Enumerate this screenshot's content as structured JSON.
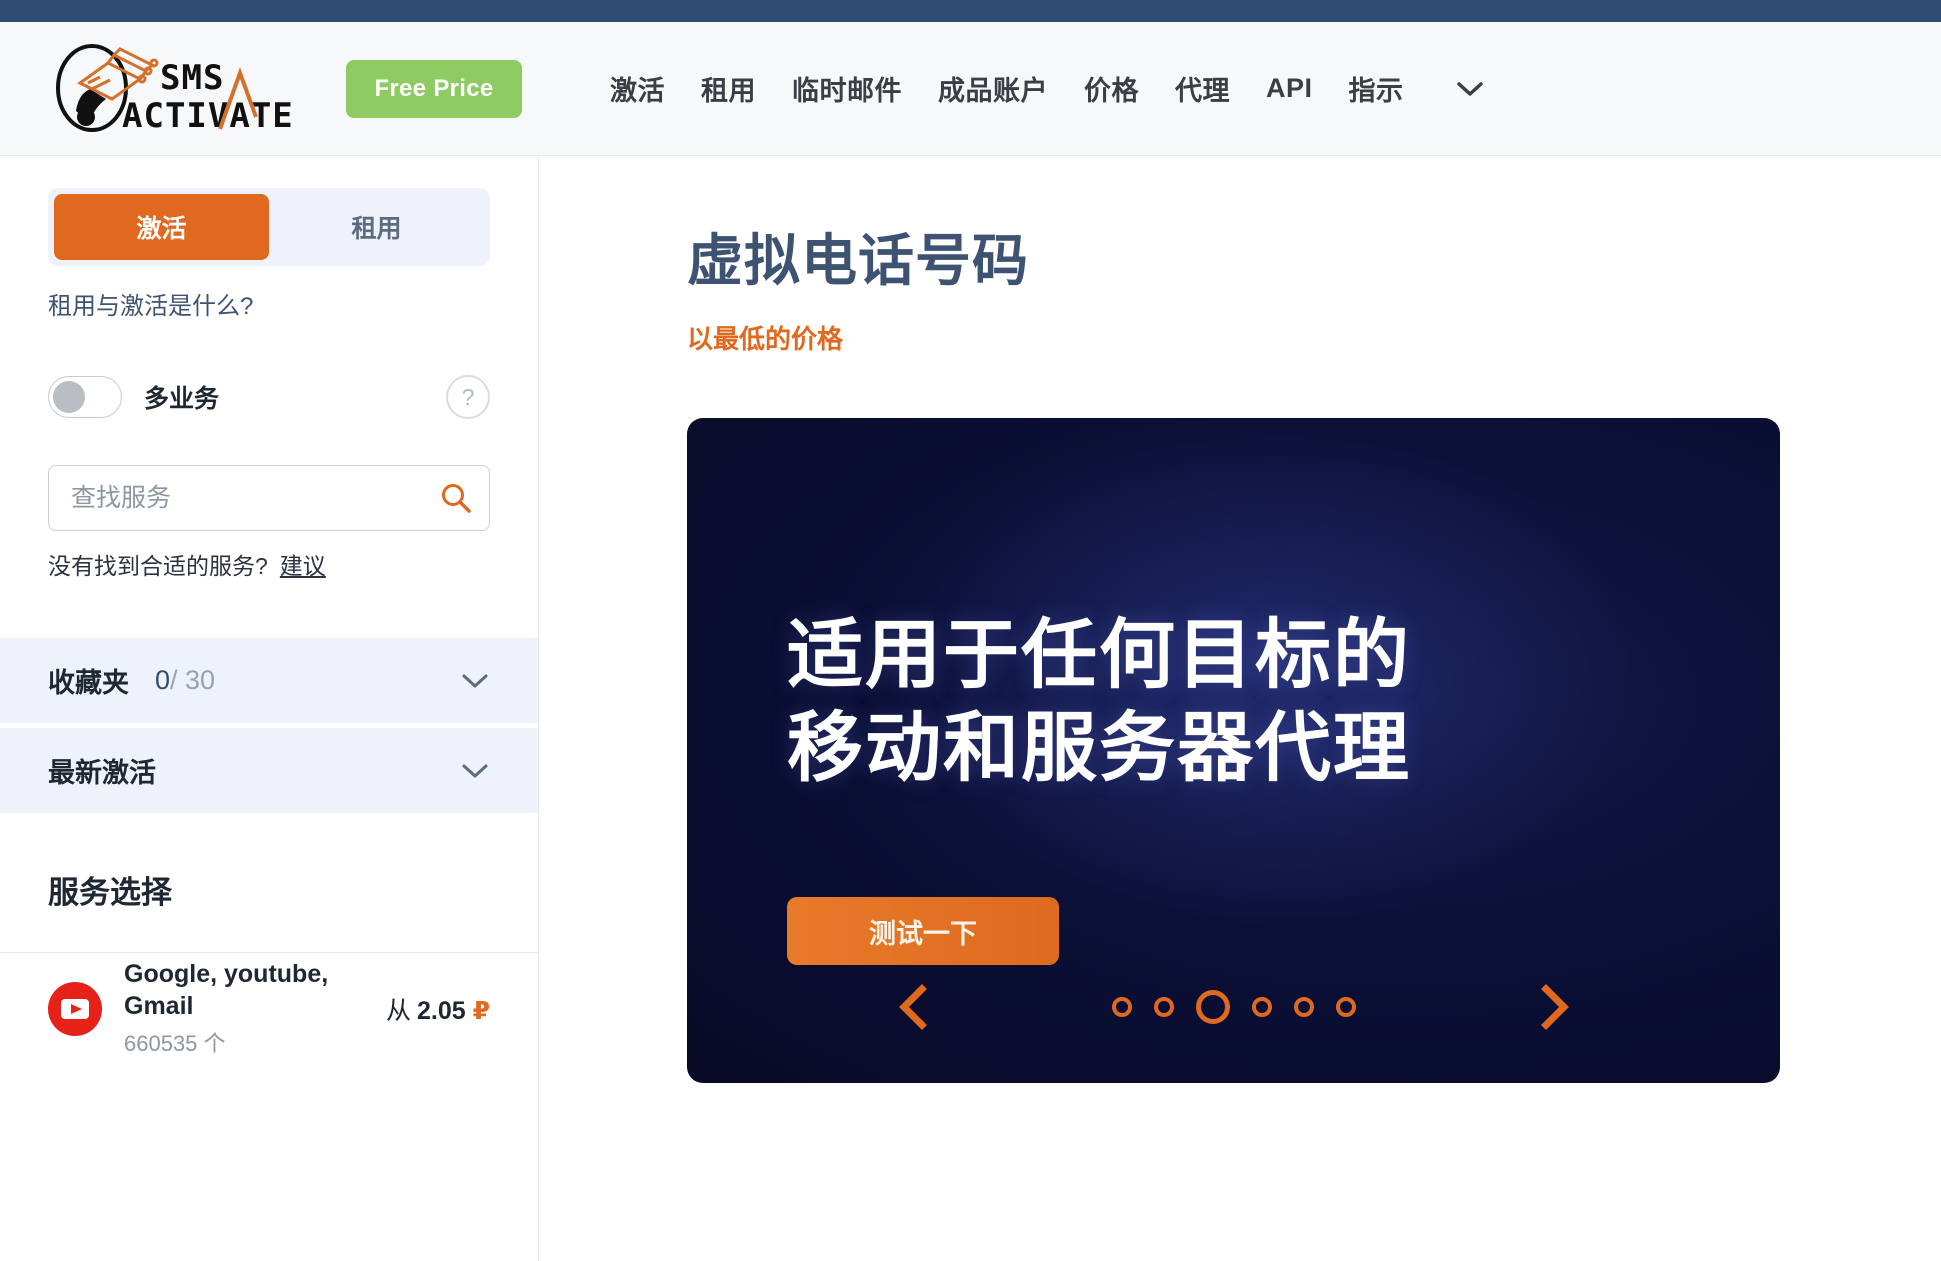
{
  "header": {
    "logo_text_top": "SMS",
    "logo_text_bottom": "ACTIVATE",
    "free_price_label": "Free Price",
    "nav_items": [
      {
        "label": "激活"
      },
      {
        "label": "租用"
      },
      {
        "label": "临时邮件"
      },
      {
        "label": "成品账户"
      },
      {
        "label": "价格"
      },
      {
        "label": "代理"
      },
      {
        "label": "API"
      },
      {
        "label": "指示"
      }
    ],
    "nav_caret_icon": "chevron-down-icon"
  },
  "sidebar": {
    "tabs": [
      {
        "label": "激活",
        "active": true
      },
      {
        "label": "租用",
        "active": false
      }
    ],
    "tab_help_link": "租用与激活是什么?",
    "multiservice": {
      "label": "多业务",
      "state": "off",
      "help_icon_label": "?"
    },
    "search": {
      "placeholder": "查找服务",
      "value": "",
      "icon": "search-icon"
    },
    "no_service_text": "没有找到合适的服务?",
    "no_service_link": "建议",
    "favorites": {
      "title": "收藏夹",
      "current": "0",
      "total": "/ 30",
      "chevron_icon": "chevron-down-icon"
    },
    "recent": {
      "title": "最新激活",
      "chevron_icon": "chevron-down-icon"
    },
    "service_selection_title": "服务选择",
    "services": [
      {
        "icon": "youtube-icon",
        "name": "Google, youtube, Gmail",
        "count": "660535 个",
        "price_from": "从",
        "price_amount": "2.05",
        "price_currency": "₽"
      }
    ]
  },
  "main": {
    "title": "虚拟电话号码",
    "subtitle": "以最低的价格",
    "banner": {
      "line1": "适用于任何目标的",
      "line2": "移动和服务器代理",
      "cta_label": "测试一下",
      "prev_icon": "chevron-left-icon",
      "next_icon": "chevron-right-icon",
      "dots_total": 6,
      "dot_active_index": 2
    }
  },
  "colors": {
    "topstrip": "#2f4c73",
    "accent_orange": "#e0691f",
    "green": "#8ecb62",
    "title_blue": "#3e5372",
    "banner_dark": "#0c1038"
  }
}
